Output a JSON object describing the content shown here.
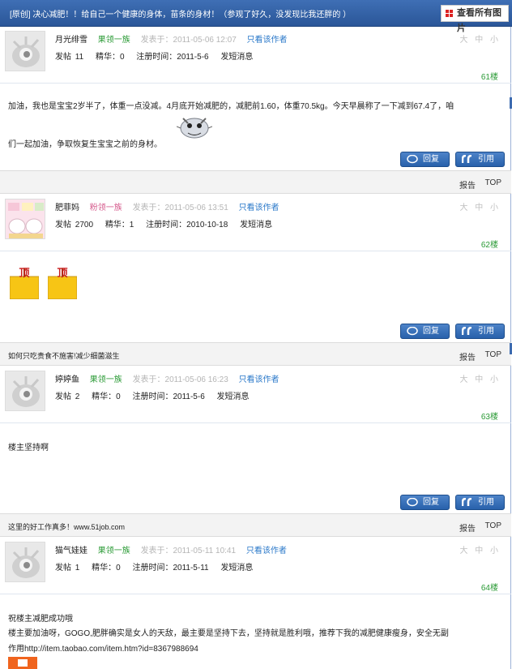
{
  "header": {
    "title": "[原创] 决心减肥！！给自己一个健康的身体，苗条的身材！（参观了好久，没发现比我还胖的 ）",
    "view_all_images": "查看所有图片"
  },
  "posts": [
    {
      "username": "月光绯雪",
      "rank": "果领一族",
      "posted_at": "发表于：2011-05-06 12:07",
      "only_author": "只看该作者",
      "font_sizes": "大 中 小",
      "stats": "发帖 11",
      "essence": "精华：0",
      "registered": "注册时间：2011-5-6",
      "message": "发短消息",
      "floor": "61楼",
      "content": [
        "加油，我也是宝宝2岁半了，体重一点没减。4月底开始减肥的，减肥前1.60，体重70.5kg。今天早晨称了一下减到67.4了，咱",
        "们一起加油，争取恢复生宝宝之前的身材。"
      ],
      "reply": "回复",
      "quote": "引用",
      "footer_ad": "",
      "report": "报告",
      "top": "TOP"
    },
    {
      "username": "肥菲妈",
      "rank": "粉领一族",
      "posted_at": "发表于：2011-05-06 13:51",
      "only_author": "只看该作者",
      "font_sizes": "大 中 小",
      "stats": "发帖 2700",
      "essence": "精华：1",
      "registered": "注册时间：2010-10-18",
      "message": "发短消息",
      "floor": "62楼",
      "ding_labels": [
        "顶",
        "顶"
      ],
      "reply": "回复",
      "quote": "引用",
      "footer_ad": "如何只吃贵食不施害!减少细菌滋生",
      "report": "报告",
      "top": "TOP"
    },
    {
      "username": "婷婷鱼",
      "rank": "果领一族",
      "posted_at": "发表于：2011-05-06 16:23",
      "only_author": "只看该作者",
      "font_sizes": "大 中 小",
      "stats": "发帖 2",
      "essence": "精华：0",
      "registered": "注册时间：2011-5-6",
      "message": "发短消息",
      "floor": "63楼",
      "content": [
        "楼主坚持啊"
      ],
      "reply": "回复",
      "quote": "引用",
      "footer_ad": "这里的好工作真多！www.51job.com",
      "report": "报告",
      "top": "TOP"
    },
    {
      "username": "猫气娃娃",
      "rank": "果领一族",
      "posted_at": "发表于：2011-05-11 10:41",
      "only_author": "只看该作者",
      "font_sizes": "大 中 小",
      "stats": "发帖 1",
      "essence": "精华：0",
      "registered": "注册时间：2011-5-11",
      "message": "发短消息",
      "floor": "64楼",
      "content": [
        "祝楼主减肥成功哦",
        "楼主要加油呀，GOGO,肥胖确实是女人的天敌，最主要是坚持下去，坚持就是胜利哦，推荐下我的减肥健康瘦身，安全无副",
        "作用http://item.taobao.com/item.htm?id=8367988694"
      ]
    }
  ],
  "colors": {
    "header_bg": "#2a5698",
    "button_bg": "#2861ab",
    "rank_green": "#2a9a35",
    "rank_pink": "#d55a8c",
    "link_blue": "#2a78c9"
  }
}
